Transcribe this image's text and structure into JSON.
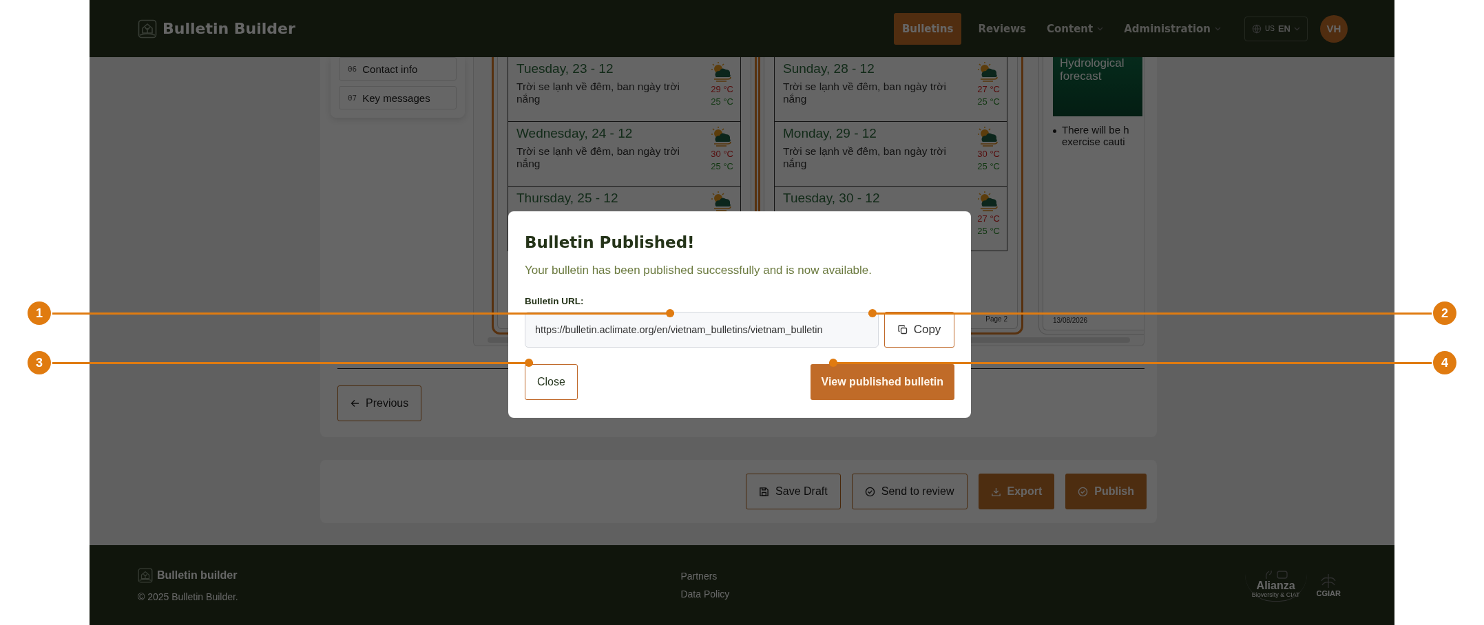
{
  "header": {
    "brand": "Bulletin Builder",
    "nav": [
      {
        "label": "Bulletins",
        "selected": true,
        "dropdown": false
      },
      {
        "label": "Reviews",
        "selected": false,
        "dropdown": false
      },
      {
        "label": "Content",
        "selected": false,
        "dropdown": true
      },
      {
        "label": "Administration",
        "selected": false,
        "dropdown": true
      }
    ],
    "language": {
      "flag": "US",
      "code": "EN"
    },
    "avatar": "VH"
  },
  "sidebar": {
    "items": [
      {
        "number": "06",
        "label": "Contact info"
      },
      {
        "number": "07",
        "label": "Key messages"
      }
    ]
  },
  "preview": {
    "pages": [
      {
        "selected": true,
        "days": [
          {
            "day": "Tuesday, 23 - 12",
            "description": "Trời se lạnh về đêm, ban ngày trời nắng",
            "high": "29 °C",
            "low": "25 °C"
          },
          {
            "day": "Wednesday, 24 - 12",
            "description": "Trời se lạnh về đêm, ban ngày trời nắng",
            "high": "30 °C",
            "low": "25 °C"
          },
          {
            "day": "Thursday, 25 - 12"
          }
        ]
      },
      {
        "selected": true,
        "days": [
          {
            "day": "Sunday, 28 - 12",
            "description": "Trời se lạnh về đêm, ban ngày trời nắng",
            "high": "27 °C",
            "low": "25 °C"
          },
          {
            "day": "Monday, 29 - 12",
            "description": "Trời se lạnh về đêm, ban ngày trời nắng",
            "high": "30 °C",
            "low": "25 °C"
          },
          {
            "day": "Tuesday, 30 - 12",
            "high": "27 °C",
            "low": "25 °C"
          }
        ],
        "footer": "Page 2"
      },
      {
        "selected": false,
        "banner": "Hydrological forecast",
        "bullet_lines": [
          "There will be h",
          "exercise cauti"
        ],
        "footer": "13/08/2026"
      }
    ]
  },
  "previous_button": "Previous",
  "actions": [
    {
      "label": "Save Draft",
      "kind": "outline"
    },
    {
      "label": "Send to review",
      "kind": "outline"
    },
    {
      "label": "Export",
      "kind": "filled"
    },
    {
      "label": "Publish",
      "kind": "filled"
    }
  ],
  "dialog": {
    "title": "Bulletin Published!",
    "message": "Your bulletin has been published successfully and is now available.",
    "url_label": "Bulletin URL:",
    "url": "https://bulletin.aclimate.org/en/vietnam_bulletins/vietnam_bulletin",
    "copy_button": "Copy",
    "close_button": "Close",
    "view_button": "View published bulletin"
  },
  "callouts": [
    {
      "number": "1"
    },
    {
      "number": "2"
    },
    {
      "number": "3"
    },
    {
      "number": "4"
    }
  ],
  "footer": {
    "brand": "Bulletin builder",
    "copyright": "© 2025 Bulletin Builder.",
    "links": [
      "Partners",
      "Data Policy"
    ],
    "logos": [
      {
        "kind": "alliance",
        "name": "Alianza",
        "subtitle": "Bioversity & CIAT"
      },
      {
        "kind": "cgiar",
        "name": "CGIAR"
      }
    ]
  }
}
